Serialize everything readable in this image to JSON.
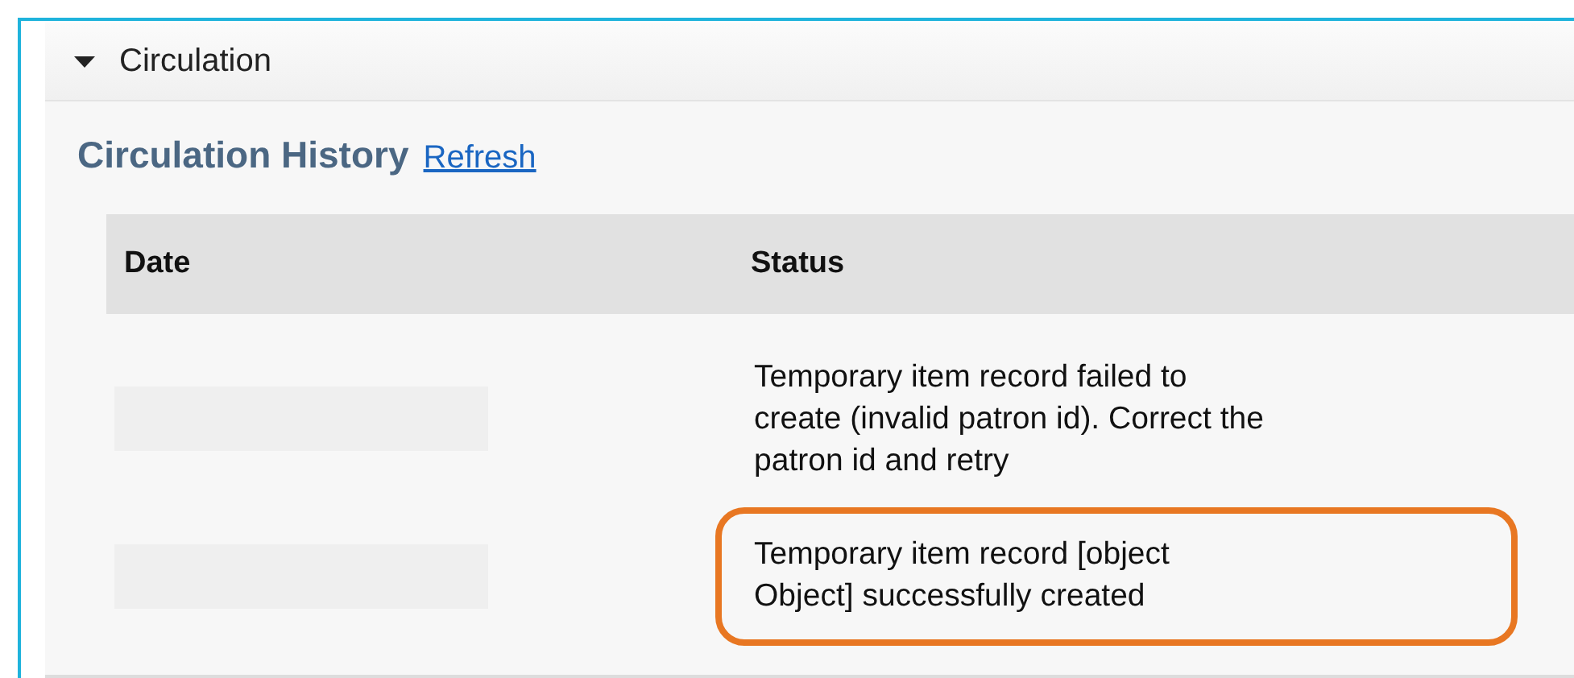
{
  "section": {
    "title": "Circulation",
    "expanded": true
  },
  "history": {
    "title": "Circulation History",
    "refresh_link": "Refresh",
    "columns": [
      "Date",
      "Status"
    ],
    "rows": [
      {
        "status": "Temporary item record failed to create (invalid patron id). Correct the patron id and retry",
        "highlighted": false
      },
      {
        "status": "Temporary item record [object Object] successfully created",
        "highlighted": true
      }
    ]
  }
}
